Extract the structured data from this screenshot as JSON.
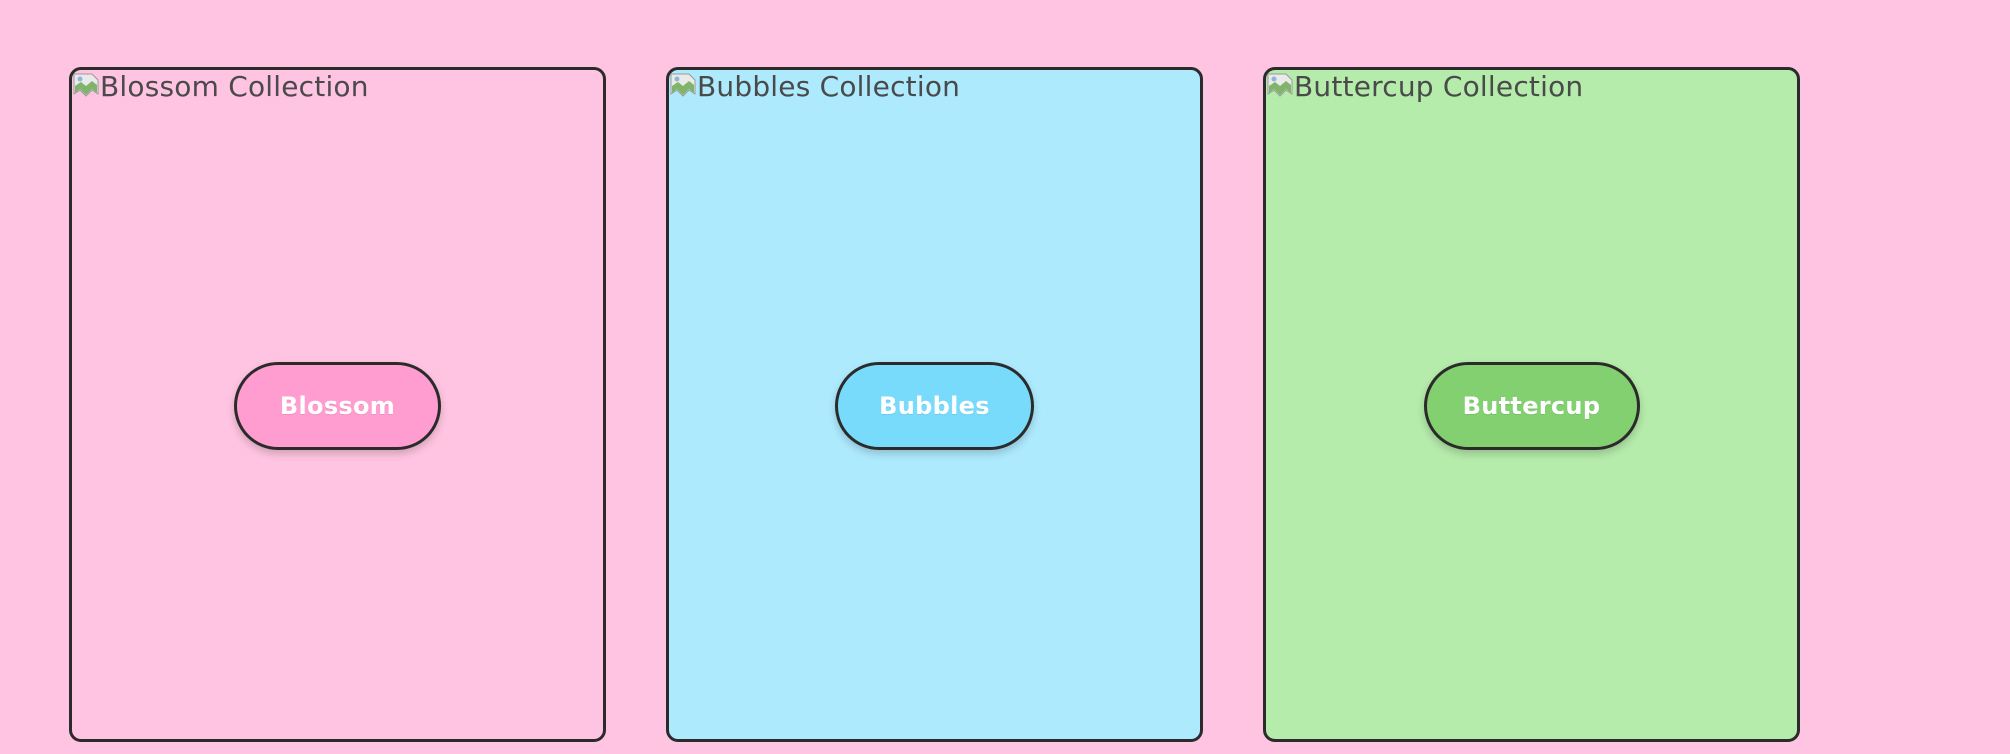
{
  "page": {
    "background": "#ffc4e1"
  },
  "cards": [
    {
      "id": "blossom",
      "image_alt": "Blossom Collection",
      "button_label": "Blossom",
      "card_color": "#ffc4e1",
      "button_color": "#ff9dd1"
    },
    {
      "id": "bubbles",
      "image_alt": "Bubbles Collection",
      "button_label": "Bubbles",
      "card_color": "#aeeafe",
      "button_color": "#79dbfc"
    },
    {
      "id": "buttercup",
      "image_alt": "Buttercup Collection",
      "button_label": "Buttercup",
      "card_color": "#b5ebab",
      "button_color": "#82d06f"
    }
  ],
  "icons": {
    "broken_image": "broken-image-icon"
  }
}
